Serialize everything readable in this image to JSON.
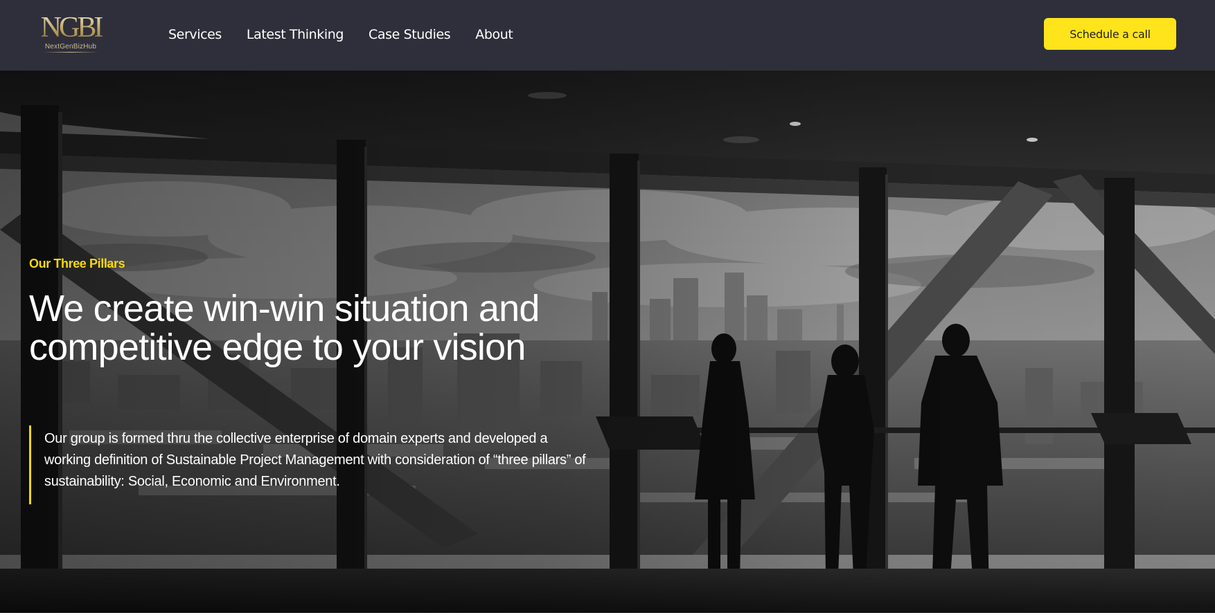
{
  "header": {
    "logo_mark": "NGBI",
    "logo_text": "NextGenBizHub",
    "nav": [
      {
        "label": "Services"
      },
      {
        "label": "Latest Thinking"
      },
      {
        "label": "Case Studies"
      },
      {
        "label": "About"
      }
    ],
    "cta_label": "Schedule a call"
  },
  "hero": {
    "eyebrow": "Our Three Pillars",
    "headline": "We create win-win situation and competitive edge to your vision",
    "body": "Our group is formed thru the collective enterprise of domain experts and developed a working definition of Sustainable Project Management with consideration of “three pillars” of sustainability: Social, Economic and Environment.",
    "background_image": "black-and-white office with floor-to-ceiling windows, city skyline, three silhouetted people"
  },
  "colors": {
    "header_bg": "#2f2f3b",
    "accent_yellow": "#ffe41b",
    "eyebrow_yellow": "#f5d90a",
    "text_white": "#ffffff"
  }
}
